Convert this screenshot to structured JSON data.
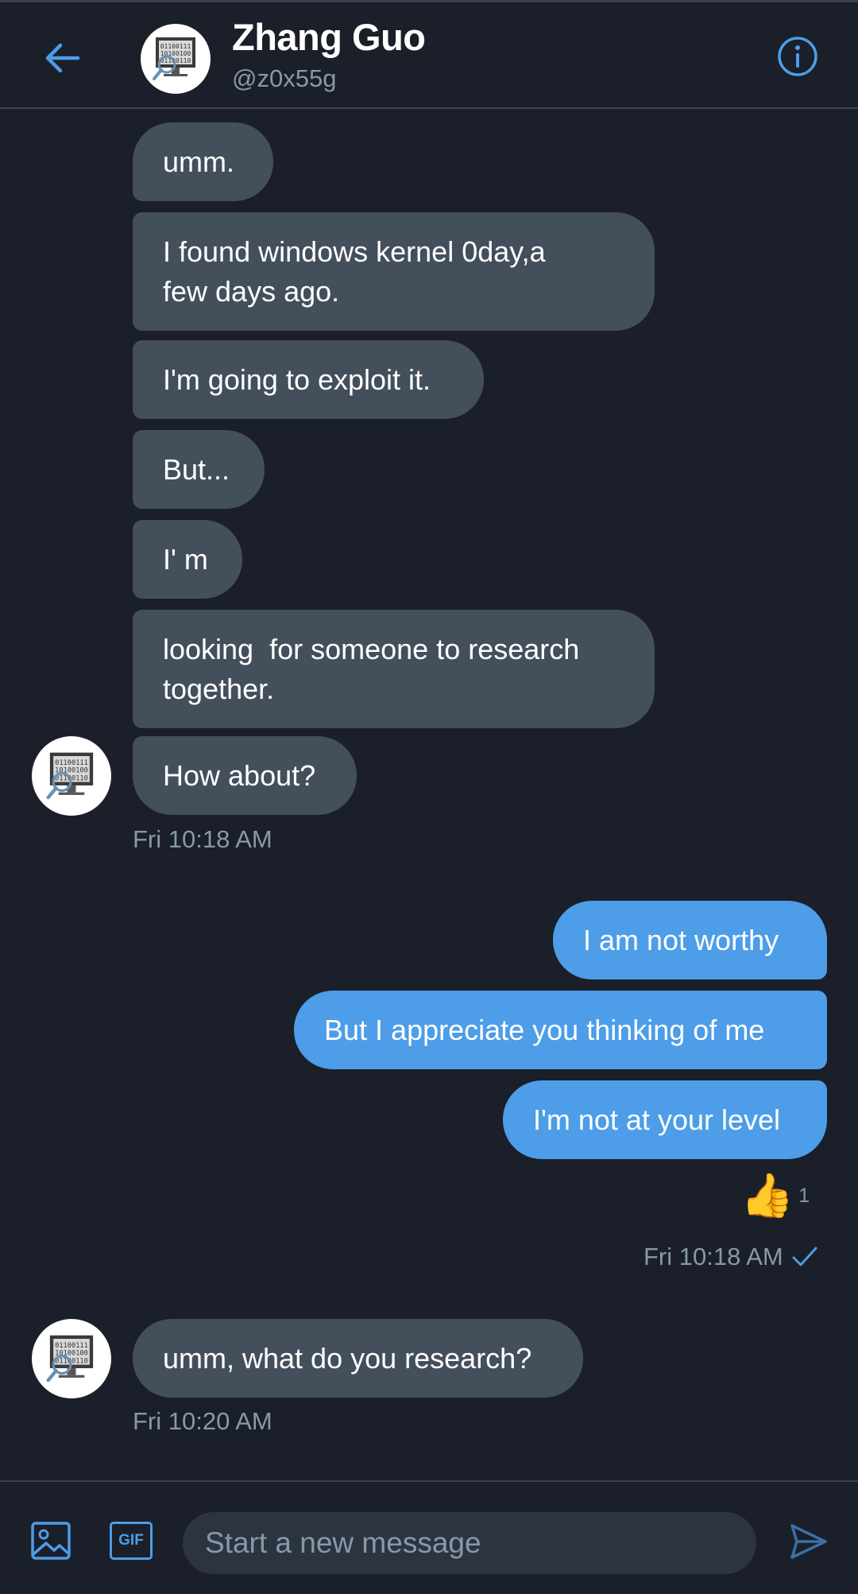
{
  "colors": {
    "background": "#1a1f29",
    "received_bubble": "#444f5c",
    "sent_bubble": "#4d9de8",
    "accent": "#4d9de8",
    "muted_text": "#8899a6"
  },
  "header": {
    "name": "Zhang Guo",
    "handle": "@z0x55g",
    "back_icon": "arrow-left-icon",
    "info_icon": "info-circle-icon"
  },
  "messages": {
    "received_group_1": [
      "umm.",
      "I found windows kernel 0day,a few days ago.",
      "I'm going to exploit it.",
      "But...",
      "I' m",
      "looking  for someone to research together.",
      "How about?"
    ],
    "received_group_1_time": "Fri 10:18 AM",
    "sent_group": [
      "I am not worthy",
      "But I appreciate you thinking of me",
      "I'm not at your level"
    ],
    "sent_reaction": {
      "emoji": "👍",
      "count": "1"
    },
    "sent_group_time": "Fri 10:18 AM",
    "sent_status_icon": "checkmark-icon",
    "received_group_2": [
      "umm, what do you research?"
    ],
    "received_group_2_time": "Fri 10:20 AM"
  },
  "composer": {
    "placeholder": "Start a new message",
    "value": "",
    "gif_label": "GIF",
    "image_icon": "image-icon",
    "send_icon": "send-icon"
  }
}
